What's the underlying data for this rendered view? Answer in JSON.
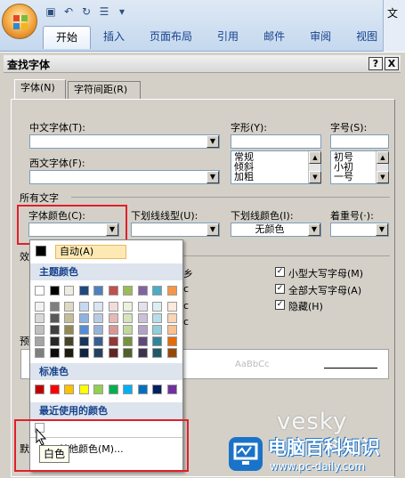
{
  "ribbon": {
    "tabs": [
      "开始",
      "插入",
      "页面布局",
      "引用",
      "邮件",
      "审阅",
      "视图"
    ],
    "active_tab": "开始",
    "doc_right_text": "文"
  },
  "dialog": {
    "title": "查找字体",
    "help_btn": "?",
    "close_btn": "X",
    "tabs": [
      "字体(N)",
      "字符间距(R)"
    ],
    "chinese_font_label": "中文字体(T):",
    "western_font_label": "西文字体(F):",
    "style_label": "字形(Y):",
    "size_label": "字号(S):",
    "style_list": [
      "常规",
      "倾斜",
      "加粗"
    ],
    "size_list": [
      "初号",
      "小初",
      "一号"
    ],
    "all_text_label": "所有文字",
    "font_color_label": "字体颜色(C):",
    "underline_label": "下划线线型(U):",
    "underline_color_label": "下划线颜色(I):",
    "underline_color_value": "无颜色",
    "emphasis_label": "着重号(·):",
    "effects_label": "效",
    "preview_label": "预",
    "preview_sample": "AaBbCc",
    "checkboxes": [
      {
        "label": "小型大写字母(M)",
        "checked": true
      },
      {
        "label": "全部大写字母(A)",
        "checked": true
      },
      {
        "label": "隐藏(H)",
        "checked": true
      }
    ],
    "default_btn": "默"
  },
  "color_popup": {
    "auto_label": "自动(A)",
    "theme_header": "主题颜色",
    "standard_header": "标准色",
    "recent_header": "最近使用的颜色",
    "more_colors": "其他颜色(M)...",
    "theme_top": [
      "#ffffff",
      "#000000",
      "#eeece1",
      "#1f497d",
      "#4f81bd",
      "#c0504d",
      "#9bbb59",
      "#8064a2",
      "#4bacc6",
      "#f79646"
    ],
    "theme_shades": [
      [
        "#f2f2f2",
        "#7f7f7f",
        "#ddd9c3",
        "#c6d9f0",
        "#dbe5f1",
        "#f2dcdb",
        "#ebf1dd",
        "#e5e0ec",
        "#dbeef3",
        "#fdeada"
      ],
      [
        "#d8d8d8",
        "#595959",
        "#c4bd97",
        "#8db3e2",
        "#b8cce4",
        "#e5b9b7",
        "#d7e3bc",
        "#ccc1d9",
        "#b7dde8",
        "#fbd5b5"
      ],
      [
        "#bfbfbf",
        "#3f3f3f",
        "#938953",
        "#548dd4",
        "#95b3d7",
        "#d99694",
        "#c3d69b",
        "#b2a2c7",
        "#92cddc",
        "#fac08f"
      ],
      [
        "#a5a5a5",
        "#262626",
        "#494429",
        "#17365d",
        "#366092",
        "#953734",
        "#76923c",
        "#5f497a",
        "#31859b",
        "#e36c09"
      ],
      [
        "#7f7f7f",
        "#0c0c0c",
        "#1d1b10",
        "#0f243e",
        "#244061",
        "#632423",
        "#4f6128",
        "#3f3151",
        "#205867",
        "#974806"
      ]
    ],
    "standard": [
      "#c00000",
      "#ff0000",
      "#ffc000",
      "#ffff00",
      "#92d050",
      "#00b050",
      "#00b0f0",
      "#0070c0",
      "#002060",
      "#7030a0"
    ],
    "recent": [
      "#ffffff"
    ]
  },
  "tooltip": "白色",
  "watermark": {
    "text1": "vesky",
    "text2": "电脑百科知识",
    "text3": "www.pc-daily.com"
  },
  "accent": {
    "highlight_red": "#e0202a",
    "popup_header": "#dde4ee"
  }
}
